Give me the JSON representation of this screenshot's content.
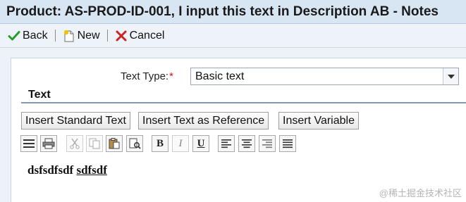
{
  "window": {
    "title": "Product: AS-PROD-ID-001, I input this text in Description AB - Notes"
  },
  "toolbar": {
    "back_label": "Back",
    "new_label": "New",
    "cancel_label": "Cancel"
  },
  "text_type": {
    "label": "Text Type:",
    "required_marker": "*",
    "selected_value": "Basic text"
  },
  "section": {
    "title": "Text"
  },
  "insert_buttons": {
    "standard_text": "Insert Standard Text",
    "text_as_reference": "Insert Text as Reference",
    "variable": "Insert Variable"
  },
  "format_toolbar": {
    "icons": [
      "spellcheck-icon",
      "print-icon",
      "cut-icon",
      "copy-icon",
      "paste-icon",
      "find-replace-icon",
      "bold-icon",
      "italic-icon",
      "underline-icon",
      "align-left-icon",
      "align-center-icon",
      "align-right-icon",
      "justify-icon"
    ],
    "bold_char": "B",
    "italic_char": "I",
    "underline_char": "U"
  },
  "editor": {
    "text_plain": "dsfsdfsdf",
    "text_underlined": "sdfsdf"
  },
  "watermark": "@稀土掘金技术社区",
  "colors": {
    "title_bar": "#d8e5f3",
    "toolbar_bg": "#eef3f9",
    "back_check": "#2a9a2a",
    "cancel_x": "#cc2222",
    "required": "#d21414",
    "section_line": "#7f98b6"
  }
}
